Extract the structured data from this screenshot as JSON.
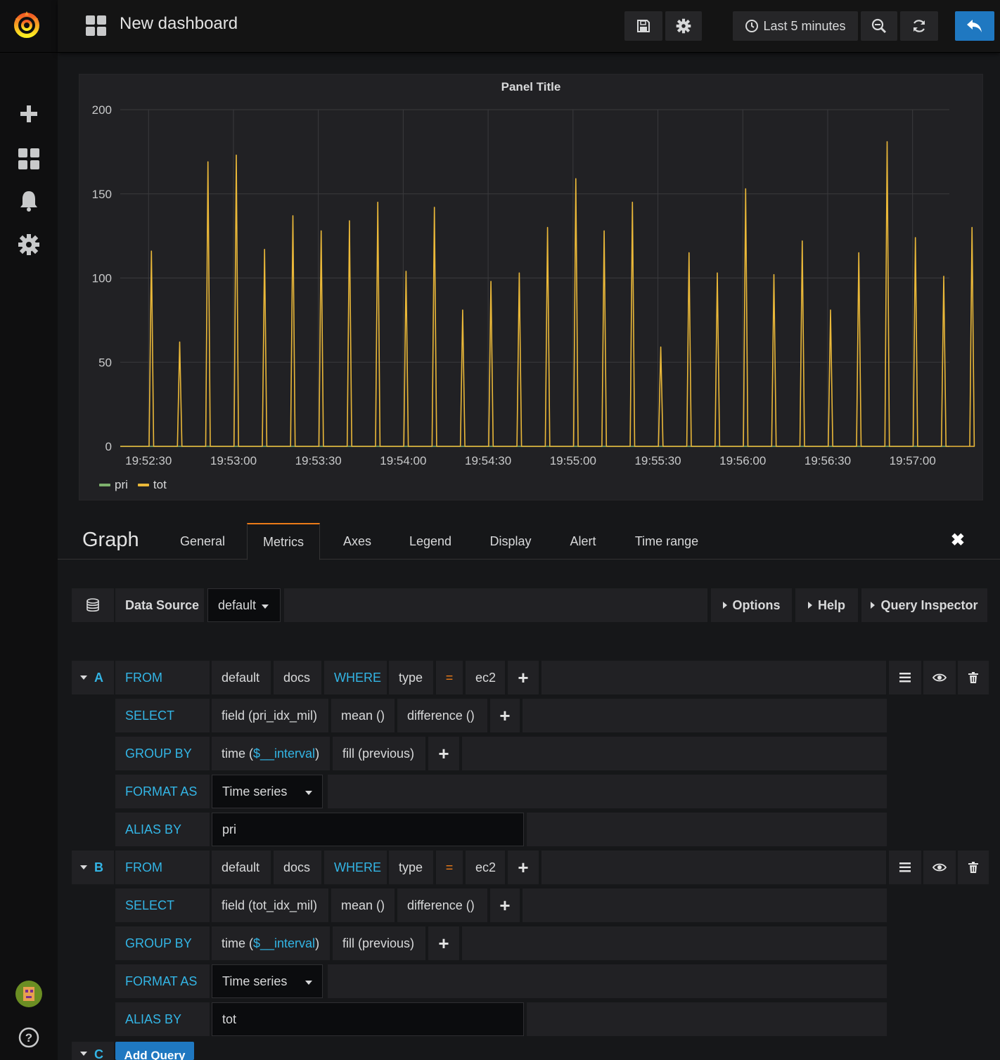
{
  "navbar": {
    "title": "New dashboard",
    "time_range": "Last 5 minutes"
  },
  "panel": {
    "title": "Panel Title"
  },
  "chart_data": {
    "type": "line",
    "title": "Panel Title",
    "xlabel": "",
    "ylabel": "",
    "ylim": [
      0,
      200
    ],
    "y_ticks": [
      "0",
      "50",
      "100",
      "150",
      "200"
    ],
    "x_ticks": [
      "19:52:30",
      "19:53:00",
      "19:53:30",
      "19:54:00",
      "19:54:30",
      "19:55:00",
      "19:55:30",
      "19:56:00",
      "19:56:30",
      "19:57:00"
    ],
    "x_range_seconds": [
      -10,
      283
    ],
    "grid": true,
    "legend_position": "bottom-left",
    "series": [
      {
        "name": "pri",
        "color": "#7eb26d",
        "peaks": []
      },
      {
        "name": "tot",
        "color": "#eab839",
        "peaks": [
          [
            1,
            116
          ],
          [
            11,
            62
          ],
          [
            21,
            169
          ],
          [
            31,
            173
          ],
          [
            41,
            117
          ],
          [
            51,
            137
          ],
          [
            61,
            128
          ],
          [
            71,
            134
          ],
          [
            81,
            145
          ],
          [
            91,
            104
          ],
          [
            101,
            142
          ],
          [
            111,
            81
          ],
          [
            121,
            98
          ],
          [
            131,
            103
          ],
          [
            141,
            130
          ],
          [
            151,
            159
          ],
          [
            161,
            128
          ],
          [
            171,
            145
          ],
          [
            181,
            59
          ],
          [
            191,
            115
          ],
          [
            201,
            103
          ],
          [
            211,
            153
          ],
          [
            221,
            102
          ],
          [
            231,
            122
          ],
          [
            241,
            81
          ],
          [
            251,
            115
          ],
          [
            261,
            181
          ],
          [
            271,
            124
          ],
          [
            281,
            101
          ],
          [
            291,
            130
          ]
        ]
      }
    ]
  },
  "editor": {
    "title": "Graph",
    "tabs": [
      "General",
      "Metrics",
      "Axes",
      "Legend",
      "Display",
      "Alert",
      "Time range"
    ]
  },
  "datasource": {
    "label": "Data Source",
    "value": "default",
    "options": "Options",
    "help": "Help",
    "inspector": "Query Inspector"
  },
  "queries": [
    {
      "ref": "A",
      "from_label": "FROM",
      "policy": "default",
      "measurement": "docs",
      "where": "WHERE",
      "tag": "type",
      "op": "=",
      "tag_value": "ec2",
      "select_label": "SELECT",
      "field": "field (pri_idx_mil)",
      "agg": "mean ()",
      "transform": "difference ()",
      "group_label": "GROUP BY",
      "group_time_pre": "time (",
      "group_time_var": "$__interval",
      "group_time_post": ")",
      "fill": "fill (previous)",
      "format_label": "FORMAT AS",
      "format": "Time series",
      "alias_label": "ALIAS BY",
      "alias": "pri"
    },
    {
      "ref": "B",
      "from_label": "FROM",
      "policy": "default",
      "measurement": "docs",
      "where": "WHERE",
      "tag": "type",
      "op": "=",
      "tag_value": "ec2",
      "select_label": "SELECT",
      "field": "field (tot_idx_mil)",
      "agg": "mean ()",
      "transform": "difference ()",
      "group_label": "GROUP BY",
      "group_time_pre": "time (",
      "group_time_var": "$__interval",
      "group_time_post": ")",
      "fill": "fill (previous)",
      "format_label": "FORMAT AS",
      "format": "Time series",
      "alias_label": "ALIAS BY",
      "alias": "tot"
    }
  ],
  "next_ref": "C",
  "add_query": "Add Query"
}
